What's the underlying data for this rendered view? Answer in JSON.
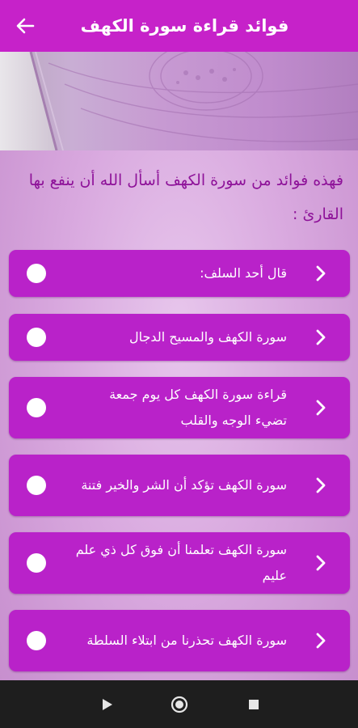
{
  "header": {
    "title": "فوائد قراءة سورة الكهف",
    "back_icon": "arrow-back-icon"
  },
  "intro_text": "فهذه فوائد من سورة الكهف أسأل الله أن ينفع بها القارئ :",
  "items": [
    {
      "label": "قال أحد السلف:"
    },
    {
      "label": "سورة الكهف والمسيح الدجال"
    },
    {
      "label": "قراءة سورة الكهف كل يوم جمعة تضيء الوجه والقلب"
    },
    {
      "label": "سورة الكهف تؤكد أن الشر والخير فتنة"
    },
    {
      "label": "سورة الكهف تعلمنا أن فوق كل ذي علم عليم"
    },
    {
      "label": "سورة الكهف تحذرنا من ابتلاء السلطة"
    }
  ],
  "colors": {
    "appbar": "#c622c9",
    "card": "#b922c9",
    "intro_text": "#8e1299"
  },
  "system_nav": {
    "icons": [
      "back-triangle-icon",
      "home-circle-icon",
      "recents-square-icon"
    ]
  }
}
